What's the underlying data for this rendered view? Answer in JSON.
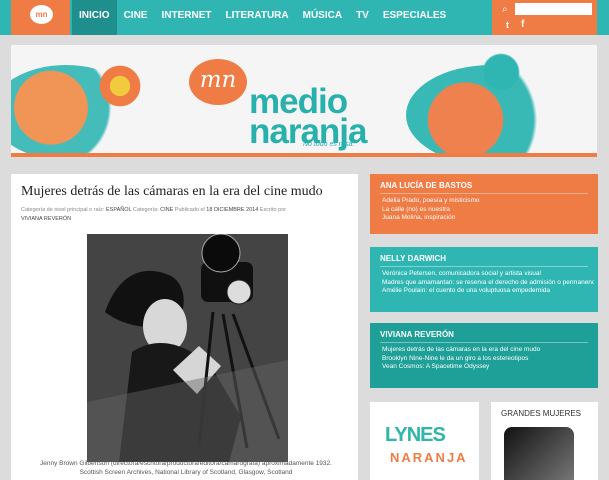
{
  "nav": {
    "logo": "mn",
    "items": [
      {
        "label": "INICIO",
        "active": true
      },
      {
        "label": "CINE"
      },
      {
        "label": "INTERNET"
      },
      {
        "label": "LITERATURA"
      },
      {
        "label": "MÚSICA"
      },
      {
        "label": "TV"
      },
      {
        "label": "ESPECIALES"
      }
    ],
    "search": {
      "placeholder": ""
    },
    "social": {
      "twitter": "t",
      "facebook": "f"
    }
  },
  "banner": {
    "logo_text": "mn",
    "title_line1": "medio",
    "title_line2": "naranja",
    "tagline": "No todo es rosa."
  },
  "article": {
    "title": "Mujeres detrás de las cámaras en la era del cine mudo",
    "meta_prefix": "Categoría de nivel principal o raíz:",
    "meta_lang": "ESPAÑOL",
    "meta_category_label": "Categoría:",
    "meta_category": "CINE",
    "meta_published_label": "Publicado el",
    "meta_date": "18 DICIEMBRE 2014",
    "meta_author_label": "Escrito por",
    "meta_author": "VIVIANA REVERÓN",
    "caption_line1": "Jenny Brown Gilbertson (directora/escritora/productora/editora/camarógrafa) aproximadamente 1932.",
    "caption_line2": "Scottish Screen Archives, National Library of Scotland, Glasgow, Scotland"
  },
  "sidebar": {
    "cards": [
      {
        "title": "ANA LUCÍA DE BASTOS",
        "links": [
          "Adelia Prado, poesía y misticismo",
          "La calle (no) es nuestra",
          "Juana Molina, inspiración"
        ]
      },
      {
        "title": "NELLY DARWICH",
        "links": [
          "Verónica Petersen, comunicadora social y artista visual",
          "Madres que amamantan: se reserva el derecho de admisión o permanencia",
          "Amélie Poulain: el cuento de una voluptuosa empedernida"
        ]
      },
      {
        "title": "VIVIANA REVERÓN",
        "links": [
          "Mujeres detrás de las cámaras en la era del cine mudo",
          "Brooklyn Nine-Nine le da un giro a los estereotipos",
          "Vean Cosmos: A Spacetime Odyssey"
        ]
      }
    ],
    "promo": {
      "line1": "LYNES",
      "line2": "NARANJA"
    },
    "grandes": {
      "title": "GRANDES MUJERES"
    }
  },
  "colors": {
    "teal": "#2fb6b3",
    "orange": "#ef7b45",
    "dark_teal": "#1e9f97"
  }
}
